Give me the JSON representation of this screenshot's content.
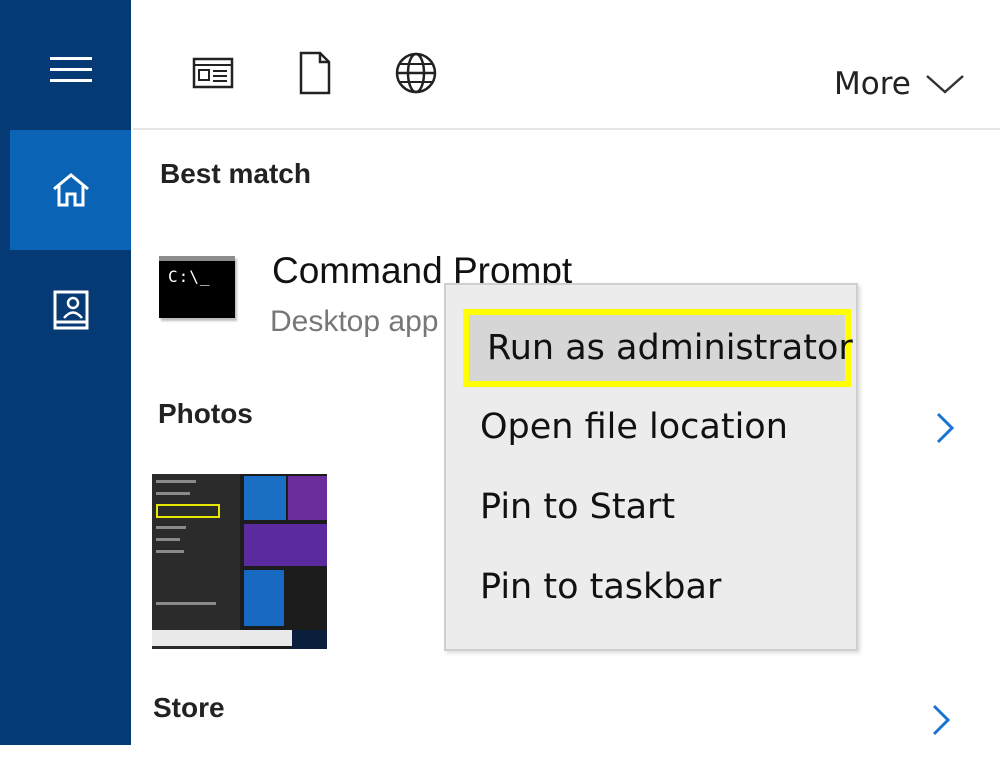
{
  "toolbar": {
    "more_label": "More",
    "icons": [
      "apps-icon",
      "document-icon",
      "web-icon"
    ]
  },
  "sidebar": {
    "items": [
      {
        "name": "menu",
        "icon": "hamburger-icon"
      },
      {
        "name": "home",
        "icon": "home-icon",
        "selected": true
      },
      {
        "name": "notebook",
        "icon": "notebook-icon"
      }
    ]
  },
  "sections": {
    "best_match": "Best match",
    "photos": "Photos",
    "store": "Store"
  },
  "best_match_item": {
    "title": "Command Prompt",
    "subtitle": "Desktop app",
    "icon_text": "C:\\_"
  },
  "context_menu": {
    "items": [
      "Run as administrator",
      "Open file location",
      "Pin to Start",
      "Pin to taskbar"
    ],
    "highlighted_index": 0
  },
  "colors": {
    "rail": "#063a74",
    "rail_selected": "#0a63b4",
    "accent": "#0078d7",
    "highlight_border": "#ffff00"
  }
}
